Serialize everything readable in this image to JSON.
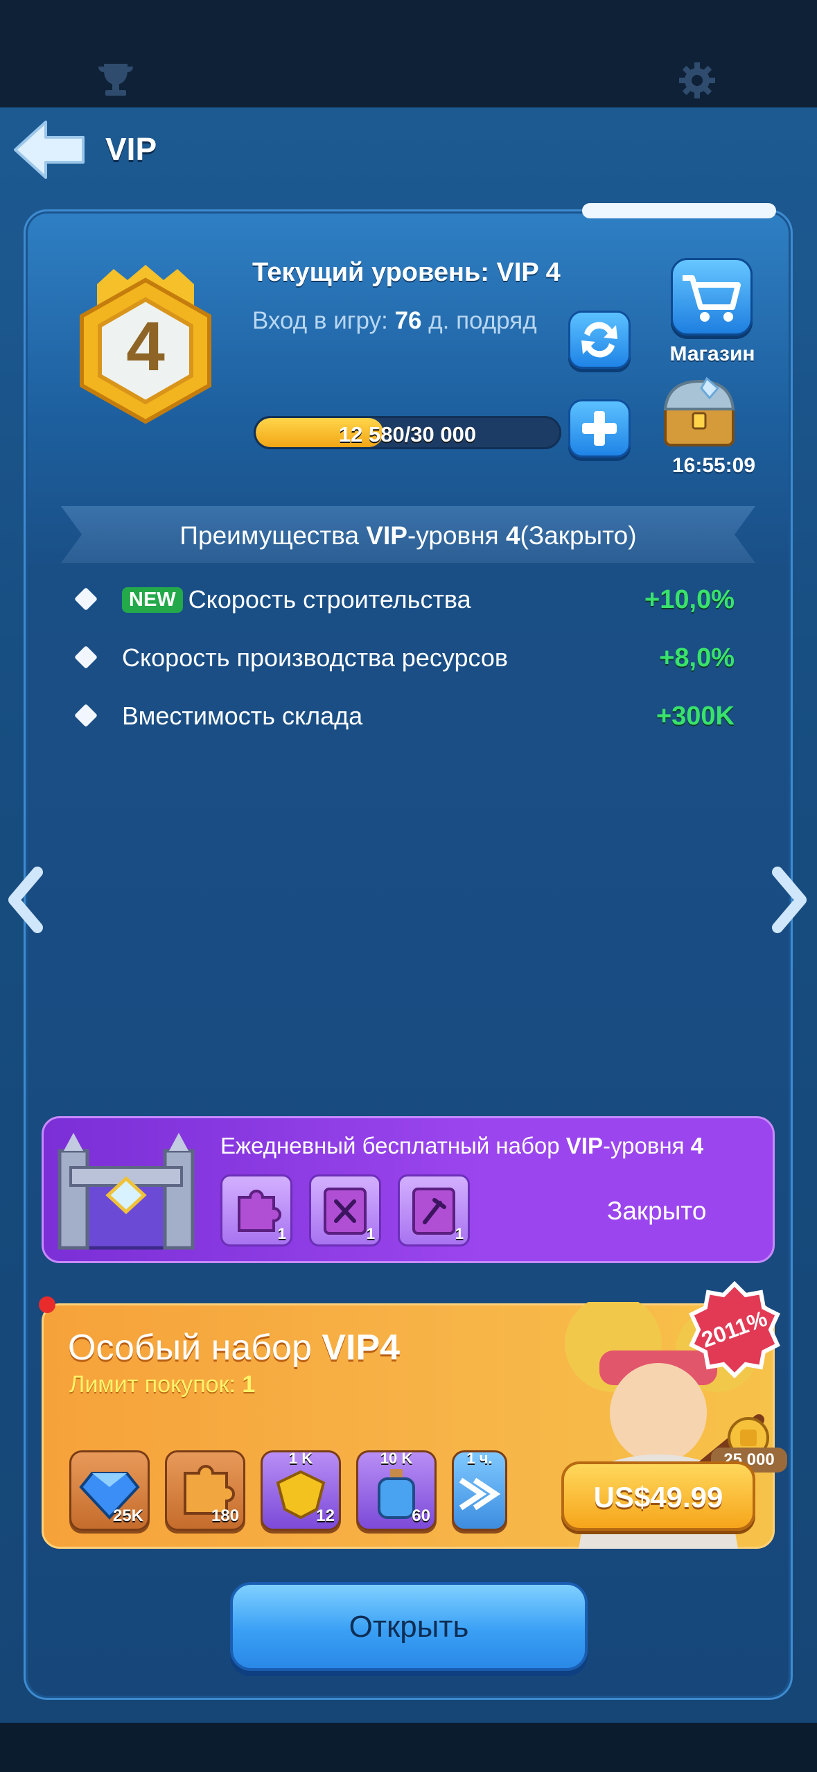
{
  "header": {
    "title": "VIP"
  },
  "vip": {
    "level_digit": "4",
    "current_level": "Текущий уровень: VIP 4",
    "login_prefix": "Вход в игру: ",
    "login_days": "76",
    "login_suffix": " д. подряд",
    "progress_text": "12 580/30 000",
    "progress_fraction": 0.419
  },
  "shop": {
    "label": "Магазин",
    "timer": "16:55:09"
  },
  "benefits": {
    "title_prefix": "Преимущества ",
    "title_bold": "VIP",
    "title_mid": "-уровня ",
    "title_level": "4",
    "title_suffix": "(Закрыто)",
    "items": [
      {
        "new_tag": "NEW",
        "name": "Скорость строительства",
        "value": "+10,0%"
      },
      {
        "name": "Скорость производства ресурсов",
        "value": "+8,0%"
      },
      {
        "name": "Вместимость склада",
        "value": "+300K"
      }
    ]
  },
  "daily": {
    "title_prefix": "Ежедневный бесплатный набор ",
    "title_bold": "VIP",
    "title_mid": "-уровня ",
    "title_level": "4",
    "items": [
      {
        "count": "1"
      },
      {
        "count": "1"
      },
      {
        "count": "1"
      }
    ],
    "status": "Закрыто"
  },
  "special": {
    "title_prefix": "Особый набор ",
    "title_bold": "VIP4",
    "limit_prefix": "Лимит покупок: ",
    "limit_value": "1",
    "discount": "2011%",
    "coins": "25 000",
    "price": "US$49.99",
    "rewards": [
      {
        "top": "",
        "count": "25K",
        "icon": "diamond-icon"
      },
      {
        "top": "",
        "count": "180",
        "icon": "hero-puzzle-icon"
      },
      {
        "top": "1 K",
        "count": "12",
        "icon": "gold-shield-icon"
      },
      {
        "top": "10 K",
        "count": "60",
        "icon": "exp-potion-icon"
      },
      {
        "top": "1 ч.",
        "count": "",
        "icon": "speedup-icon"
      }
    ]
  },
  "actions": {
    "open_label": "Открыть"
  },
  "colors": {
    "accent_green": "#39e36b",
    "panel_blue": "#17477a",
    "purple": "#9b45ee",
    "orange": "#f7b347"
  }
}
